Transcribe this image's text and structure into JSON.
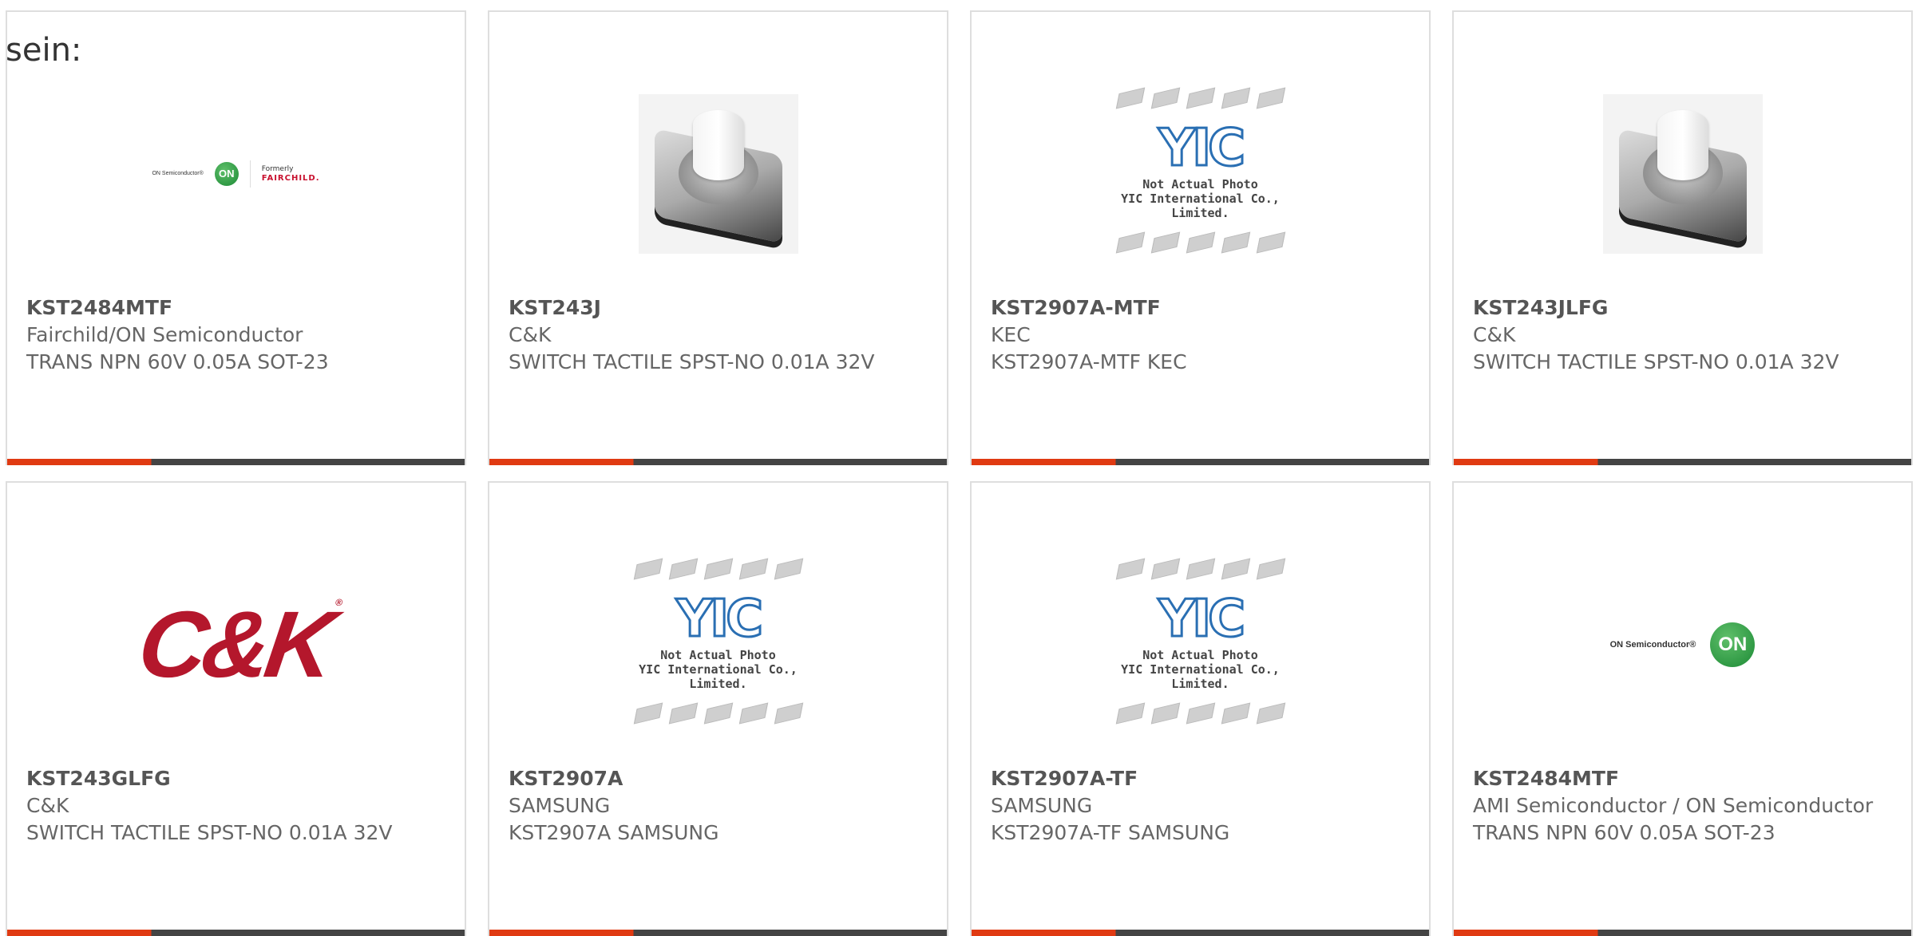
{
  "intro": "sein:",
  "products": [
    {
      "part": "KST2484MTF",
      "maker": "Fairchild/ON Semiconductor",
      "desc": "TRANS NPN 60V 0.05A SOT-23",
      "image": "on-fairchild-logo"
    },
    {
      "part": "KST243J",
      "maker": "C&K",
      "desc": "SWITCH TACTILE SPST-NO 0.01A 32V",
      "image": "tactile-switch-photo"
    },
    {
      "part": "KST2907A-MTF",
      "maker": "KEC",
      "desc": "KST2907A-MTF KEC",
      "image": "yic-placeholder"
    },
    {
      "part": "KST243JLFG",
      "maker": "C&K",
      "desc": "SWITCH TACTILE SPST-NO 0.01A 32V",
      "image": "tactile-switch-photo"
    },
    {
      "part": "KST243GLFG",
      "maker": "C&K",
      "desc": "SWITCH TACTILE SPST-NO 0.01A 32V",
      "image": "ck-logo"
    },
    {
      "part": "KST2907A",
      "maker": "SAMSUNG",
      "desc": "KST2907A SAMSUNG",
      "image": "yic-placeholder"
    },
    {
      "part": "KST2907A-TF",
      "maker": "SAMSUNG",
      "desc": "KST2907A-TF SAMSUNG",
      "image": "yic-placeholder"
    },
    {
      "part": "KST2484MTF",
      "maker": "AMI Semiconductor / ON Semiconductor",
      "desc": "TRANS NPN 60V 0.05A SOT-23",
      "image": "on-logo"
    }
  ],
  "logos": {
    "on_semi_text": "ON Semiconductor®",
    "on_badge": "ON",
    "fairchild_small": "Formerly",
    "fairchild_name": "FAIRCHILD.",
    "ck_text": "C&K",
    "ck_reg": "®",
    "yic_logo": "YIC",
    "yic_caption_1": "Not Actual Photo",
    "yic_caption_2": "YIC International Co., Limited."
  },
  "colors": {
    "accent": "#e03a12",
    "bar_dark": "#444444",
    "border": "#dedede",
    "text": "#666666"
  }
}
